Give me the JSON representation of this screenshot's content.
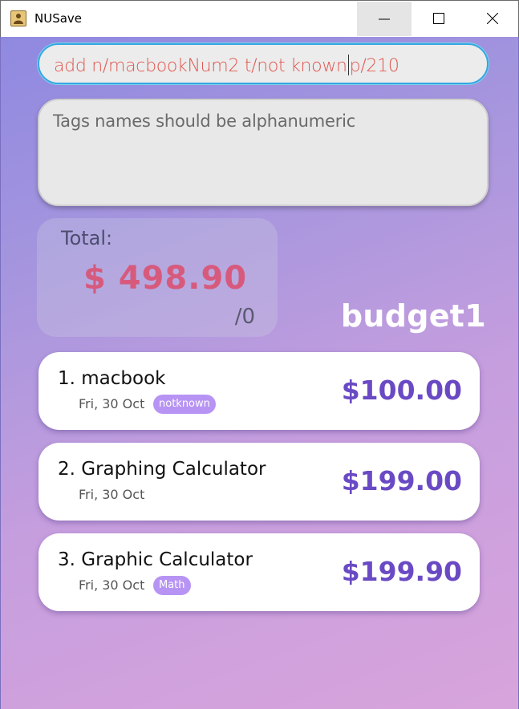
{
  "window": {
    "title": "NUSave",
    "icon": "address-book-icon",
    "controls": [
      "minimize-icon",
      "maximize-icon",
      "close-icon"
    ]
  },
  "command": {
    "value_before_caret": "add n/macbookNum2 t/not known",
    "value_after_caret": "p/210"
  },
  "result": {
    "message": "Tags names should be alphanumeric"
  },
  "total": {
    "label": "Total:",
    "amount": "$ 498.90",
    "budget": "/0"
  },
  "budget_name": "budget1",
  "purchases": [
    {
      "title": "1. macbook",
      "date": "Fri, 30 Oct",
      "tag": "notknown",
      "price": "$100.00"
    },
    {
      "title": "2. Graphing Calculator",
      "date": "Fri, 30 Oct",
      "tag": "",
      "price": "$199.00"
    },
    {
      "title": "3. Graphic Calculator",
      "date": "Fri, 30 Oct",
      "tag": "Math",
      "price": "$199.90"
    }
  ],
  "colors": {
    "accent": "#6a4ac4",
    "total_amount": "#d75a7d",
    "command_text": "#e0574f",
    "tag": "#b794f4",
    "focus_border": "#35a8e0"
  }
}
